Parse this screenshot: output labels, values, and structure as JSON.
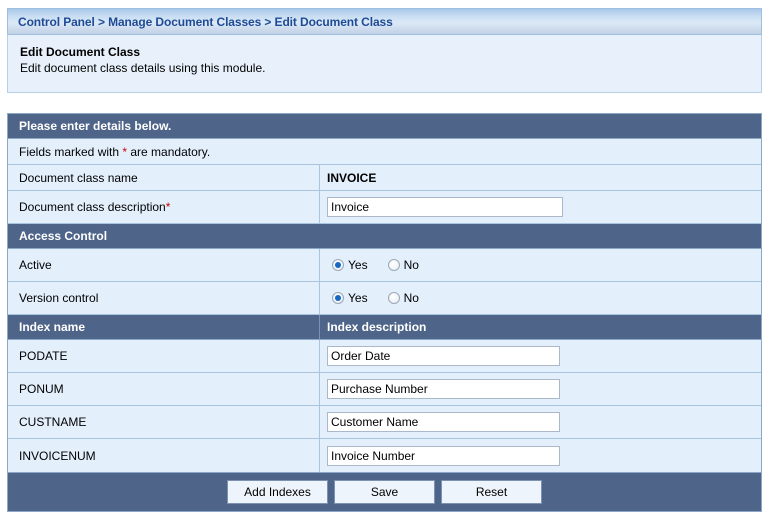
{
  "breadcrumb": {
    "text": "Control Panel > Manage Document Classes > Edit Document Class"
  },
  "intro": {
    "title": "Edit Document Class",
    "subtitle": "Edit document class details using this module."
  },
  "form": {
    "header": "Please enter details below.",
    "mandatory_note_prefix": "Fields marked with ",
    "mandatory_star": "*",
    "mandatory_note_suffix": " are mandatory.",
    "class_name_label": "Document class name",
    "class_name_value": "INVOICE",
    "class_desc_label": "Document class description ",
    "class_desc_star": "*",
    "class_desc_value": "Invoice",
    "access_control_header": "Access Control",
    "active_label": "Active",
    "version_label": "Version control",
    "radio_yes": "Yes",
    "radio_no": "No",
    "active_value": "Yes",
    "version_value": "Yes",
    "index_name_header": "Index name",
    "index_desc_header": "Index description",
    "indexes": [
      {
        "name": "PODATE",
        "description": "Order Date"
      },
      {
        "name": "PONUM",
        "description": "Purchase Number"
      },
      {
        "name": "CUSTNAME",
        "description": "Customer Name"
      },
      {
        "name": "INVOICENUM",
        "description": "Invoice Number"
      }
    ]
  },
  "buttons": {
    "add_indexes": "Add Indexes",
    "save": "Save",
    "reset": "Reset"
  },
  "colors": {
    "section_header_bg": "#4e6489",
    "row_bg": "#e4effc",
    "crumb_text": "#1f4b96",
    "required_star": "#cc0000",
    "radio_dot": "#1767c4"
  }
}
